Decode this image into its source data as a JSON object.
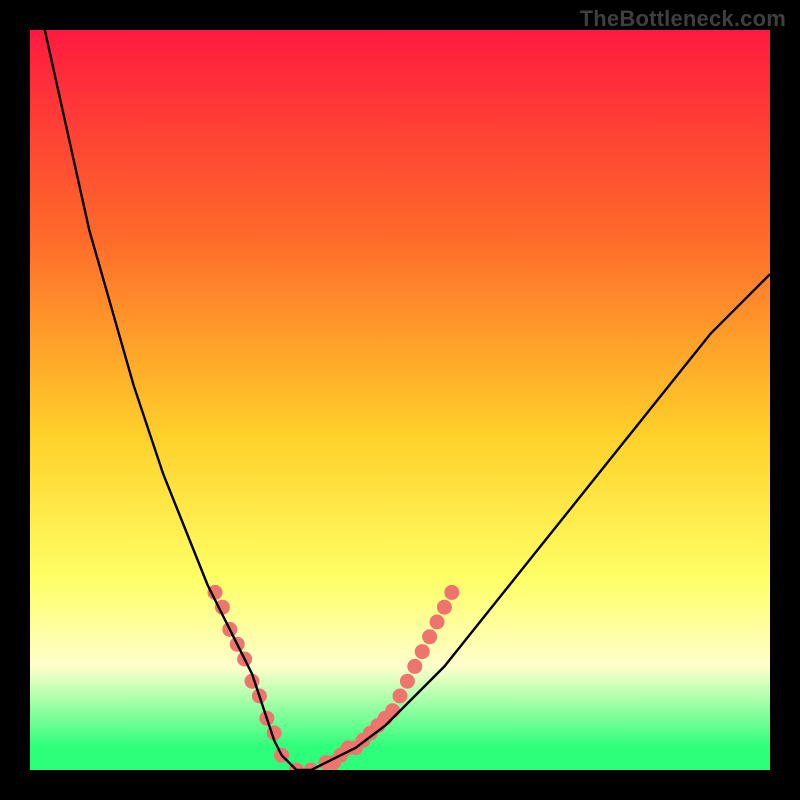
{
  "watermark": "TheBottleneck.com",
  "colors": {
    "bg_top": "#ff1a3f",
    "bg_mid1": "#ff6a2a",
    "bg_mid2": "#ffd12a",
    "bg_mid3": "#ffff66",
    "bg_pale": "#ffffcc",
    "bg_bottom": "#2cff7a",
    "curve": "#000000",
    "marker": "#ee756e",
    "frame": "#000000"
  },
  "chart_data": {
    "type": "line",
    "title": "",
    "xlabel": "",
    "ylabel": "",
    "xlim": [
      0,
      100
    ],
    "ylim": [
      0,
      100
    ],
    "grid": false,
    "legend": false,
    "series": [
      {
        "name": "bottleneck-curve",
        "x": [
          2,
          4,
          6,
          8,
          10,
          12,
          14,
          16,
          18,
          20,
          22,
          24,
          26,
          28,
          30,
          31,
          32,
          33,
          34,
          36,
          38,
          40,
          44,
          48,
          52,
          56,
          60,
          64,
          68,
          72,
          76,
          80,
          84,
          88,
          92,
          96,
          100
        ],
        "y": [
          100,
          91,
          82,
          73,
          66,
          59,
          52,
          46,
          40,
          35,
          30,
          25,
          21,
          17,
          13,
          10,
          7,
          4,
          2,
          0,
          0,
          1,
          3,
          6,
          10,
          14,
          19,
          24,
          29,
          34,
          39,
          44,
          49,
          54,
          59,
          63,
          67
        ]
      }
    ],
    "markers": [
      {
        "x": 25,
        "y": 24
      },
      {
        "x": 26,
        "y": 22
      },
      {
        "x": 27,
        "y": 19
      },
      {
        "x": 28,
        "y": 17
      },
      {
        "x": 29,
        "y": 15
      },
      {
        "x": 30,
        "y": 12
      },
      {
        "x": 31,
        "y": 10
      },
      {
        "x": 32,
        "y": 7
      },
      {
        "x": 33,
        "y": 5
      },
      {
        "x": 34,
        "y": 2
      },
      {
        "x": 36,
        "y": 0
      },
      {
        "x": 38,
        "y": 0
      },
      {
        "x": 40,
        "y": 1
      },
      {
        "x": 41,
        "y": 1
      },
      {
        "x": 42,
        "y": 2
      },
      {
        "x": 43,
        "y": 3
      },
      {
        "x": 44,
        "y": 3
      },
      {
        "x": 45,
        "y": 4
      },
      {
        "x": 46,
        "y": 5
      },
      {
        "x": 47,
        "y": 6
      },
      {
        "x": 48,
        "y": 7
      },
      {
        "x": 49,
        "y": 8
      },
      {
        "x": 50,
        "y": 10
      },
      {
        "x": 51,
        "y": 12
      },
      {
        "x": 52,
        "y": 14
      },
      {
        "x": 53,
        "y": 16
      },
      {
        "x": 54,
        "y": 18
      },
      {
        "x": 55,
        "y": 20
      },
      {
        "x": 56,
        "y": 22
      },
      {
        "x": 57,
        "y": 24
      }
    ],
    "gradient_stops": [
      {
        "offset": 0.0,
        "color": "#ff1a3f"
      },
      {
        "offset": 0.28,
        "color": "#ff6a2a"
      },
      {
        "offset": 0.55,
        "color": "#ffd12a"
      },
      {
        "offset": 0.74,
        "color": "#ffff66"
      },
      {
        "offset": 0.86,
        "color": "#ffffcc"
      },
      {
        "offset": 0.97,
        "color": "#2cff7a"
      }
    ]
  }
}
